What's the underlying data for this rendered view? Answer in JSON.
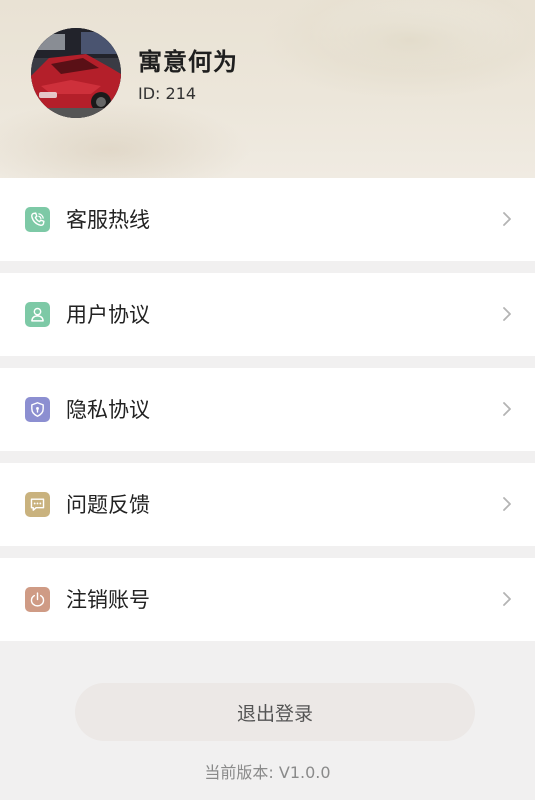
{
  "profile": {
    "name": "寓意何为",
    "id_text": "ID: 214"
  },
  "menu": {
    "items": [
      {
        "label": "客服热线",
        "icon": "phone-icon",
        "icon_color": "#7dc9a6"
      },
      {
        "label": "用户协议",
        "icon": "user-icon",
        "icon_color": "#7dc9a6"
      },
      {
        "label": "隐私协议",
        "icon": "shield-icon",
        "icon_color": "#8c8fd1"
      },
      {
        "label": "问题反馈",
        "icon": "message-icon",
        "icon_color": "#c9b27e"
      },
      {
        "label": "注销账号",
        "icon": "power-icon",
        "icon_color": "#cf9b85"
      }
    ]
  },
  "footer": {
    "logout_label": "退出登录",
    "version_text": "当前版本: V1.0.0"
  },
  "colors": {
    "background": "#f1f0f0",
    "card": "#ffffff",
    "logout_button": "#ece8e6"
  }
}
